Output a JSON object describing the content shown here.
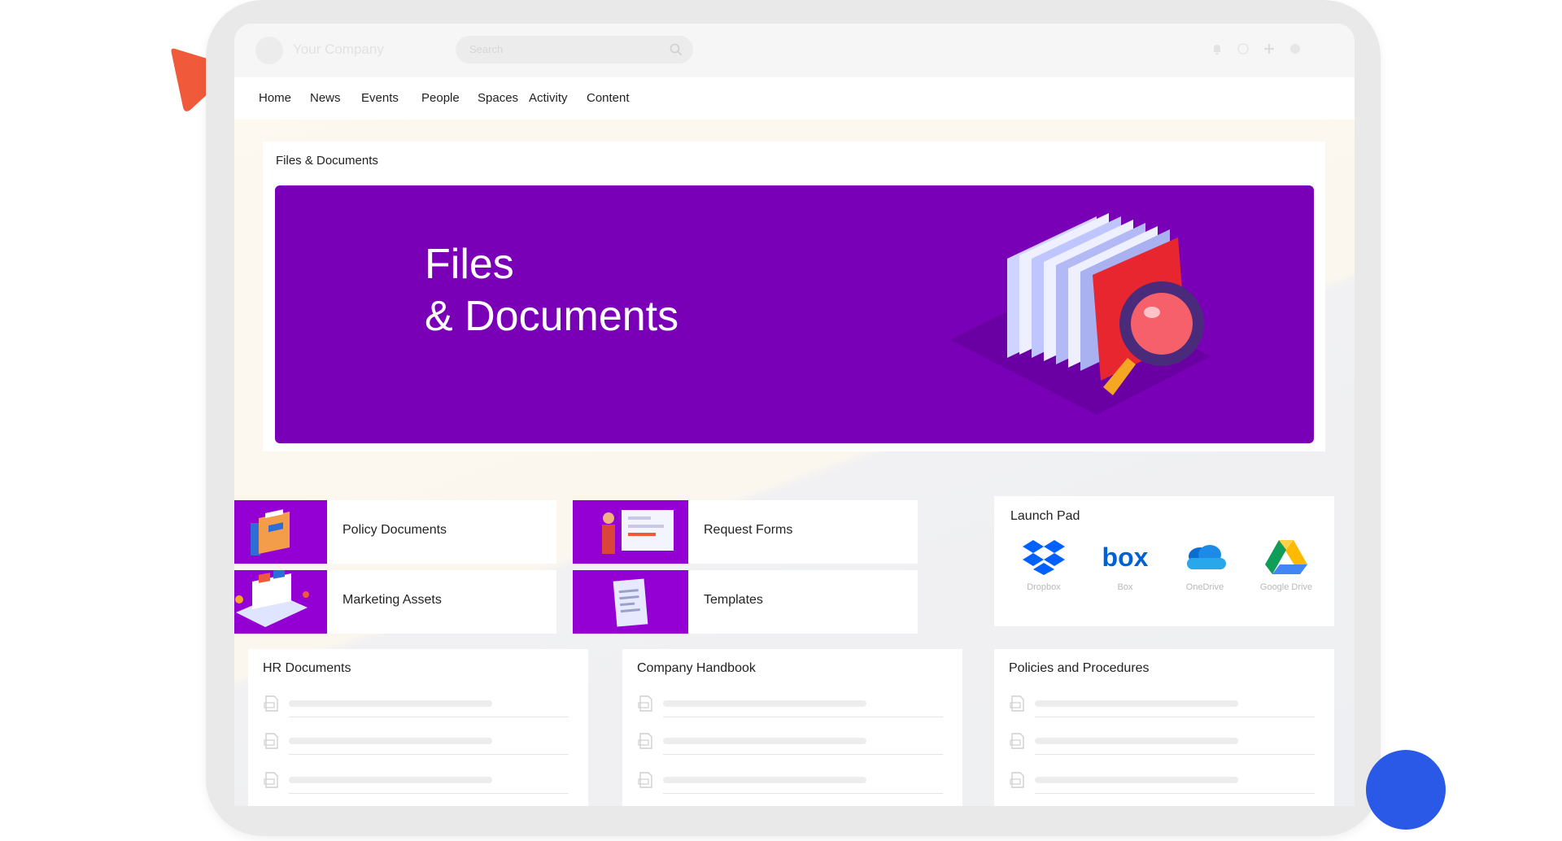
{
  "header": {
    "company_name": "Your Company",
    "search_placeholder": "Search"
  },
  "nav": {
    "items": [
      "Home",
      "News",
      "Events",
      "People",
      "Spaces",
      "Activity",
      "Content"
    ]
  },
  "hero": {
    "section_title": "Files & Documents",
    "banner_line1": "Files",
    "banner_line2": "& Documents"
  },
  "tiles": {
    "policy": "Policy Documents",
    "request": "Request Forms",
    "marketing": "Marketing Assets",
    "templates": "Templates"
  },
  "launchpad": {
    "title": "Launch Pad",
    "items": [
      {
        "label": "Dropbox",
        "icon": "dropbox-icon"
      },
      {
        "label": "Box",
        "icon": "box-icon"
      },
      {
        "label": "OneDrive",
        "icon": "onedrive-icon"
      },
      {
        "label": "Google Drive",
        "icon": "google-drive-icon"
      }
    ]
  },
  "doc_cards": {
    "hr": "HR Documents",
    "handbook": "Company Handbook",
    "policies": "Policies and Procedures"
  },
  "colors": {
    "banner_purple": "#7a00b8",
    "tile_purple": "#9400d3",
    "accent_orange": "#f05a3a",
    "accent_blue": "#2a59e8"
  }
}
